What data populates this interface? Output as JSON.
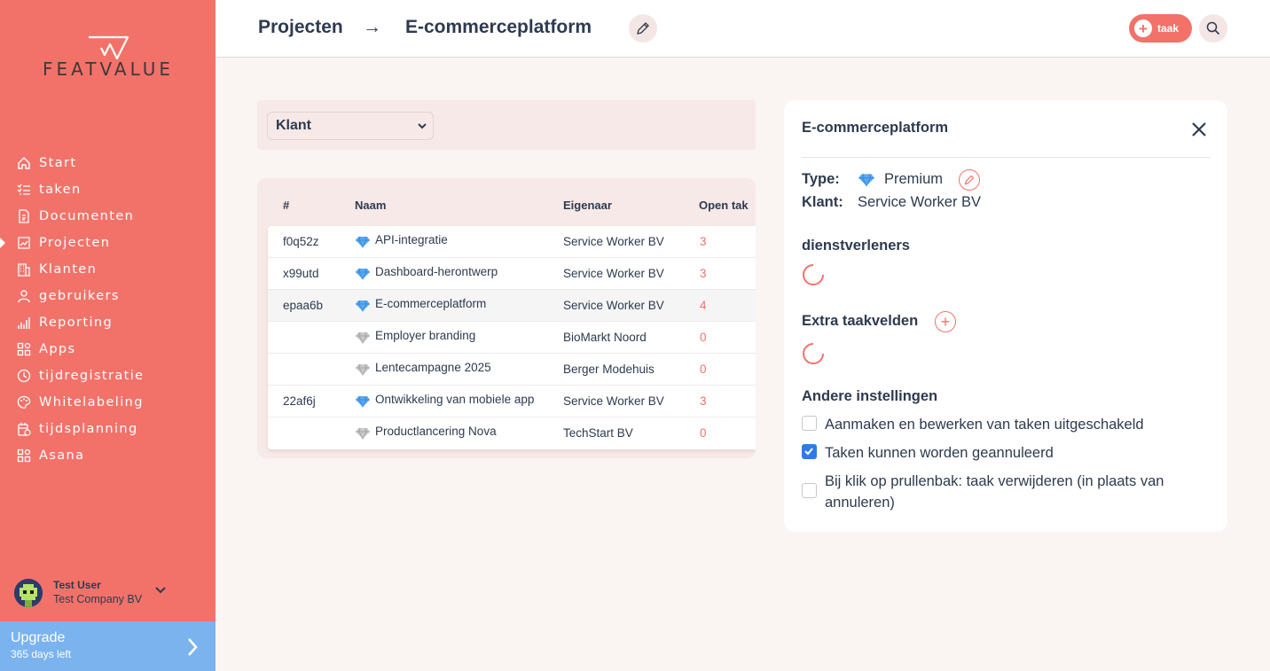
{
  "brand": {
    "name": "FEATVALUE",
    "accent": "#f2726a",
    "upgrade_color": "#7bb3ee"
  },
  "sidebar": {
    "items": [
      {
        "label": "Start",
        "icon": "home-icon"
      },
      {
        "label": "taken",
        "icon": "task-list-icon"
      },
      {
        "label": "Documenten",
        "icon": "document-icon"
      },
      {
        "label": "Projecten",
        "icon": "chart-icon",
        "active": true
      },
      {
        "label": "Klanten",
        "icon": "building-icon"
      },
      {
        "label": "gebruikers",
        "icon": "users-icon"
      },
      {
        "label": "Reporting",
        "icon": "bar-chart-icon"
      },
      {
        "label": "Apps",
        "icon": "apps-icon"
      },
      {
        "label": "tijdregistratie",
        "icon": "timer-icon"
      },
      {
        "label": "Whitelabeling",
        "icon": "palette-icon"
      },
      {
        "label": "tijdsplanning",
        "icon": "calendar-icon"
      },
      {
        "label": "Asana",
        "icon": "asana-icon"
      }
    ],
    "user": {
      "name": "Test User",
      "company": "Test Company BV"
    },
    "upgrade": {
      "title": "Upgrade",
      "subtitle": "365 days left"
    }
  },
  "header": {
    "crumb_root": "Projecten",
    "crumb_arrow": "→",
    "crumb_current": "E-commerceplatform",
    "task_button": "taak"
  },
  "filter": {
    "selected": "Klant"
  },
  "table": {
    "headers": [
      "#",
      "Naam",
      "Eigenaar",
      "Open tak"
    ],
    "rows": [
      {
        "id": "f0q52z",
        "name": "API-integratie",
        "owner": "Service Worker BV",
        "open": "3",
        "tier": "premium"
      },
      {
        "id": "x99utd",
        "name": "Dashboard-herontwerp",
        "owner": "Service Worker BV",
        "open": "3",
        "tier": "premium"
      },
      {
        "id": "epaa6b",
        "name": "E-commerceplatform",
        "owner": "Service Worker BV",
        "open": "4",
        "tier": "premium",
        "selected": true
      },
      {
        "id": "",
        "name": "Employer branding",
        "owner": "BioMarkt Noord",
        "open": "0",
        "tier": "basic"
      },
      {
        "id": "",
        "name": "Lentecampagne 2025",
        "owner": "Berger Modehuis",
        "open": "0",
        "tier": "basic"
      },
      {
        "id": "22af6j",
        "name": "Ontwikkeling van mobiele app",
        "owner": "Service Worker BV",
        "open": "3",
        "tier": "premium"
      },
      {
        "id": "",
        "name": "Productlancering Nova",
        "owner": "TechStart BV",
        "open": "0",
        "tier": "basic"
      }
    ]
  },
  "panel": {
    "title": "E-commerceplatform",
    "type_label": "Type:",
    "type_value": "Premium",
    "client_label": "Klant:",
    "client_value": "Service Worker BV",
    "providers_heading": "dienstverleners",
    "extra_fields_heading": "Extra taakvelden",
    "other_settings_heading": "Andere instellingen",
    "settings": [
      {
        "label": "Aanmaken en bewerken van taken uitgeschakeld",
        "checked": false
      },
      {
        "label": "Taken kunnen worden geannuleerd",
        "checked": true
      },
      {
        "label": "Bij klik op prullenbak: taak verwijderen (in plaats van annuleren)",
        "checked": false
      }
    ]
  }
}
